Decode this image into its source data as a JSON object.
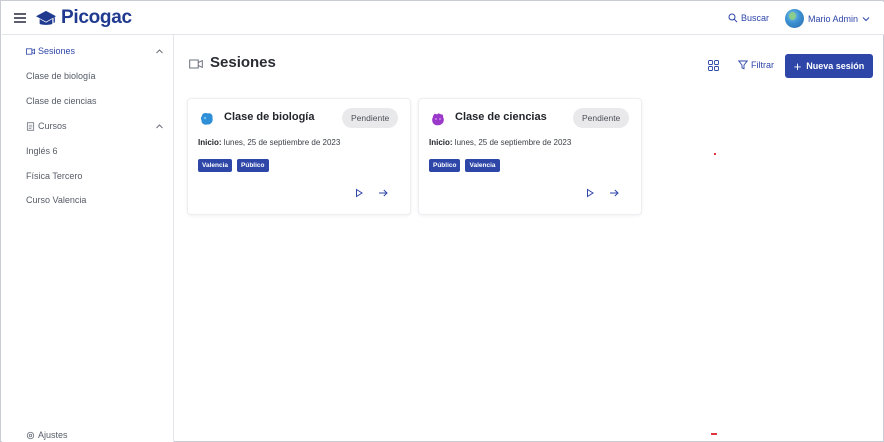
{
  "header": {
    "brand": "Picogac",
    "search_label": "Buscar",
    "user_name": "Mario Admin",
    "brand_color": "#1f3a8f"
  },
  "sidebar": {
    "sections": [
      {
        "label": "Sesiones",
        "icon": "video-icon",
        "expanded": true,
        "active": true,
        "items": [
          {
            "label": "Clase de biología"
          },
          {
            "label": "Clase de ciencias"
          }
        ]
      },
      {
        "label": "Cursos",
        "icon": "document-icon",
        "expanded": true,
        "active": false,
        "items": [
          {
            "label": "Inglés 6"
          },
          {
            "label": "Física Tercero"
          },
          {
            "label": "Curso Valencia"
          }
        ]
      }
    ],
    "footer_label": "Ajustes"
  },
  "main": {
    "title": "Sesiones",
    "filter_label": "Filtrar",
    "new_button_label": "Nueva sesión",
    "accent_color": "#2d46a8",
    "cards": [
      {
        "title": "Clase de biología",
        "status": "Pendiente",
        "date_prefix": "Inicio:",
        "date": " lunes, 25 de septiembre de 2023",
        "tags": [
          "Valencia",
          "Público"
        ],
        "icon": "blue-blob-icon",
        "icon_color": "#2f8fd6"
      },
      {
        "title": "Clase de ciencias",
        "status": "Pendiente",
        "date_prefix": "Inicio:",
        "date": " lunes, 25 de septiembre de 2023",
        "tags": [
          "Público",
          "Valencia"
        ],
        "icon": "purple-blob-icon",
        "icon_color": "#9a38c9"
      }
    ]
  }
}
